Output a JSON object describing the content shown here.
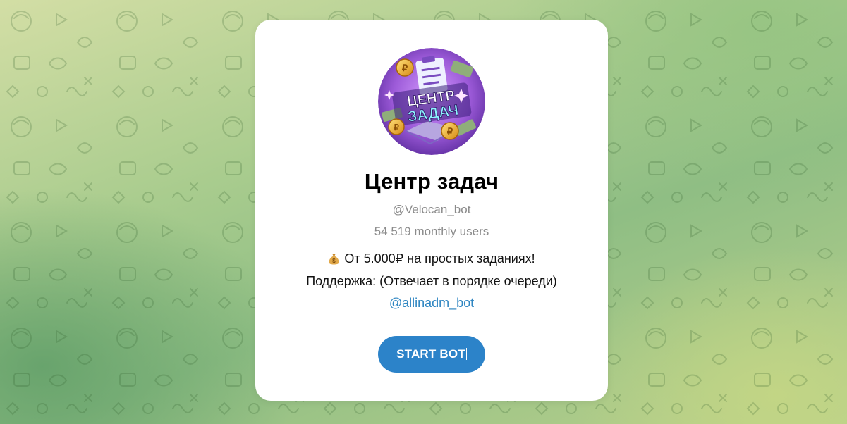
{
  "bot": {
    "name": "Центр задач",
    "username": "@Velocan_bot",
    "monthly_users": "54 519 monthly users",
    "avatar_text": [
      "ЦЕНТР",
      "ЗАДАЧ"
    ],
    "description_line1": "От 5.000₽ на простых заданиях!",
    "description_line1_icon": "money-bag-icon",
    "description_line2": "Поддержка: (Отвечает в порядке очереди)",
    "support_link": "@allinadm_bot"
  },
  "actions": {
    "start_label": "START BOT"
  },
  "colors": {
    "button": "#2c83c9",
    "link": "#2f86c2",
    "muted_text": "#8b8b8b",
    "avatar_purple": "#9c5ad8"
  }
}
